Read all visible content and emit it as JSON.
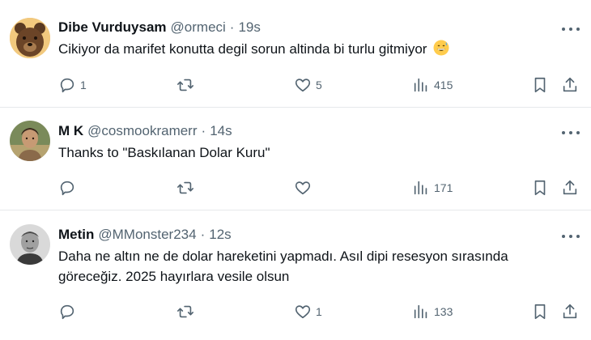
{
  "tweets": [
    {
      "name": "Dibe Vurduysam",
      "handle": "@ormeci",
      "time": "19s",
      "text": "Cikiyor da marifet konutta degil sorun altinda bi turlu gitmiyor",
      "emoji": "grinning-face-with-sweat-emoji",
      "replies": "1",
      "retweets": "",
      "likes": "5",
      "views": "415",
      "avatar": "bear-avatar"
    },
    {
      "name": "M K",
      "handle": "@cosmookramerr",
      "time": "14s",
      "text": "Thanks to \"Baskılanan Dolar Kuru\"",
      "replies": "",
      "retweets": "",
      "likes": "",
      "views": "171",
      "avatar": "portrait-avatar"
    },
    {
      "name": "Metin",
      "handle": "@MMonster234",
      "time": "12s",
      "text_line1": "Daha ne altın ne de dolar hareketini yapmadı. Asıl dipi resesyon sırasında",
      "text_line2": "göreceğiz. 2025 hayırlara vesile olsun",
      "replies": "",
      "retweets": "",
      "likes": "1",
      "views": "133",
      "avatar": "man-avatar"
    }
  ],
  "separator": "·",
  "colors": {
    "text": "#0f1419",
    "secondary": "#536471",
    "border": "#e6e9eb"
  }
}
